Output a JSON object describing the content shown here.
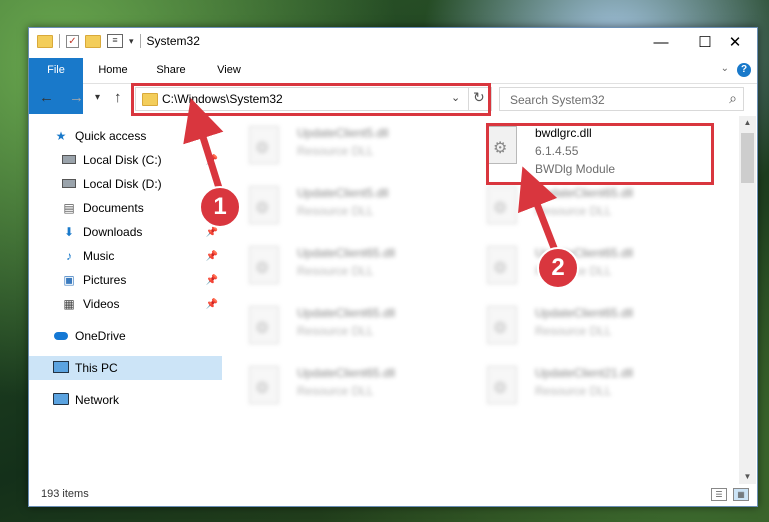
{
  "window": {
    "title": "System32",
    "controls": {
      "minimize": "—",
      "maximize": "☐",
      "close": "✕"
    }
  },
  "ribbon": {
    "tabs": [
      {
        "label": "File"
      },
      {
        "label": "Home"
      },
      {
        "label": "Share"
      },
      {
        "label": "View"
      }
    ],
    "help_icon": "?"
  },
  "navigation": {
    "address": "C:\\Windows\\System32",
    "search_placeholder": "Search System32"
  },
  "sidebar": {
    "items": [
      {
        "label": "Quick access",
        "icon": "star-icon"
      },
      {
        "label": "Local Disk (C:)",
        "icon": "drive-icon"
      },
      {
        "label": "Local Disk (D:)",
        "icon": "drive-icon"
      },
      {
        "label": "Documents",
        "icon": "document-icon"
      },
      {
        "label": "Downloads",
        "icon": "download-icon"
      },
      {
        "label": "Music",
        "icon": "music-icon"
      },
      {
        "label": "Pictures",
        "icon": "pictures-icon"
      },
      {
        "label": "Videos",
        "icon": "videos-icon"
      },
      {
        "label": "OneDrive",
        "icon": "onedrive-icon"
      },
      {
        "label": "This PC",
        "icon": "pc-icon"
      },
      {
        "label": "Network",
        "icon": "network-icon"
      }
    ]
  },
  "files": {
    "highlighted": {
      "name": "bwdlgrc.dll",
      "version": "6.1.4.55",
      "description": "BWDlg Module"
    },
    "left_column": [
      {
        "name": "UpdateClient5.dll",
        "type": "Resource DLL"
      },
      {
        "name": "UpdateClient5.dll",
        "type": "Resource DLL"
      },
      {
        "name": "UpdateClient65.dll",
        "type": "Resource DLL"
      },
      {
        "name": "UpdateClient65.dll",
        "type": "Resource DLL"
      },
      {
        "name": "UpdateClient65.dll",
        "type": "Resource DLL"
      }
    ],
    "right_column": [
      {
        "name": "UpdateClient65.dll",
        "type": "Resource DLL"
      },
      {
        "name": "UpdateClient65.dll",
        "type": "Resource DLL"
      },
      {
        "name": "UpdateClient65.dll",
        "type": "Resource DLL"
      },
      {
        "name": "UpdateClient21.dll",
        "type": "Resource DLL"
      }
    ]
  },
  "status": {
    "item_count": "193 items"
  },
  "annotations": {
    "step1": "1",
    "step2": "2",
    "color": "#d9363e"
  }
}
